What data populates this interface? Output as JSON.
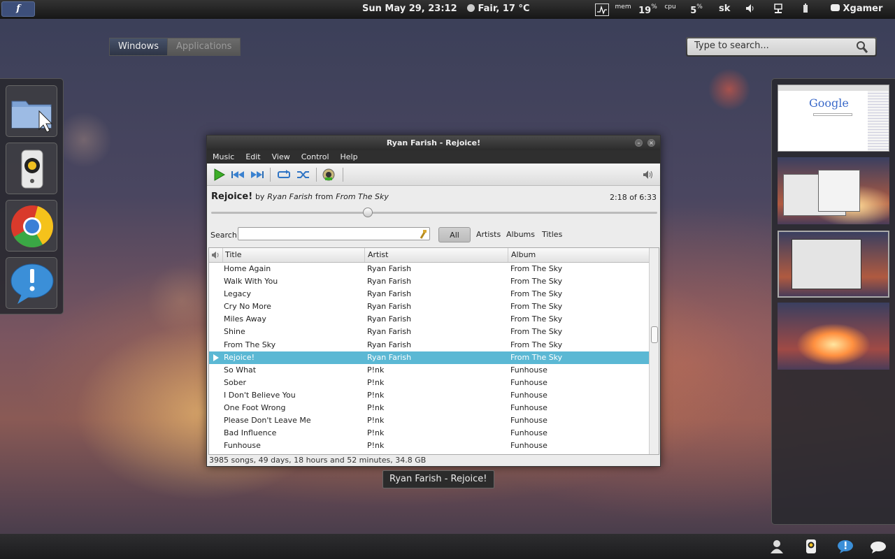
{
  "topbar": {
    "activities": "f",
    "datetime": "Sun May 29, 23:12",
    "weather": "Fair, 17 °C",
    "mem_label": "mem",
    "mem_value": "19",
    "mem_unit": "%",
    "cpu_label": "cpu",
    "cpu_value": "5",
    "cpu_unit": "%",
    "keyboard": "sk",
    "user": "Xgamer"
  },
  "overview": {
    "tabs": [
      "Windows",
      "Applications"
    ],
    "search_placeholder": "Type to search..."
  },
  "dock": {
    "items": [
      "file-manager",
      "rhythmbox",
      "chromium",
      "notifications"
    ]
  },
  "window": {
    "title": "Ryan Farish - Rejoice!",
    "menu": [
      "Music",
      "Edit",
      "View",
      "Control",
      "Help"
    ],
    "now_playing": {
      "song": "Rejoice!",
      "by": "by",
      "artist": "Ryan Farish",
      "from": "from",
      "album": "From The Sky",
      "time": "2:18 of 6:33",
      "progress": 0.351
    },
    "search_label": "Search:",
    "filters": [
      "All",
      "Artists",
      "Albums",
      "Titles"
    ],
    "columns": [
      "Title",
      "Artist",
      "Album"
    ],
    "rows": [
      {
        "title": "Home Again",
        "artist": "Ryan Farish",
        "album": "From The Sky"
      },
      {
        "title": "Walk With You",
        "artist": "Ryan Farish",
        "album": "From The Sky"
      },
      {
        "title": "Legacy",
        "artist": "Ryan Farish",
        "album": "From The Sky"
      },
      {
        "title": "Cry No More",
        "artist": "Ryan Farish",
        "album": "From The Sky"
      },
      {
        "title": "Miles Away",
        "artist": "Ryan Farish",
        "album": "From The Sky"
      },
      {
        "title": "Shine",
        "artist": "Ryan Farish",
        "album": "From The Sky"
      },
      {
        "title": "From The Sky",
        "artist": "Ryan Farish",
        "album": "From The Sky"
      },
      {
        "title": "Rejoice!",
        "artist": "Ryan Farish",
        "album": "From The Sky",
        "playing": true
      },
      {
        "title": "So What",
        "artist": "P!nk",
        "album": "Funhouse"
      },
      {
        "title": "Sober",
        "artist": "P!nk",
        "album": "Funhouse"
      },
      {
        "title": "I Don't Believe You",
        "artist": "P!nk",
        "album": "Funhouse"
      },
      {
        "title": "One Foot Wrong",
        "artist": "P!nk",
        "album": "Funhouse"
      },
      {
        "title": "Please Don't Leave Me",
        "artist": "P!nk",
        "album": "Funhouse"
      },
      {
        "title": "Bad Influence",
        "artist": "P!nk",
        "album": "Funhouse"
      },
      {
        "title": "Funhouse",
        "artist": "P!nk",
        "album": "Funhouse"
      }
    ],
    "status": "3985 songs, 49 days, 18 hours and 52 minutes, 34.8 GB"
  },
  "tooltip": "Ryan Farish - Rejoice!",
  "workspace_thumb": {
    "google_text": "Google"
  },
  "colors": {
    "selection": "#5bb8d4",
    "play_green": "#3cae27"
  }
}
